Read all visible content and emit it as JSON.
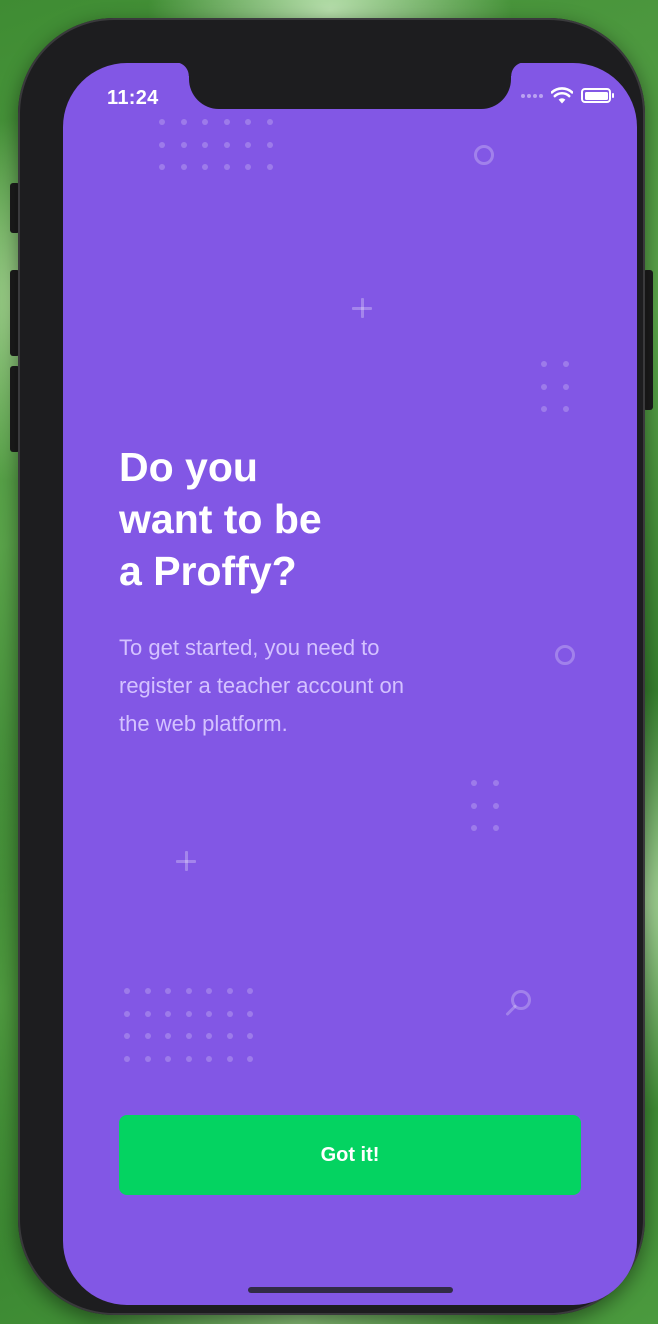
{
  "status_bar": {
    "time": "11:24"
  },
  "page": {
    "title_lines": [
      "Do you",
      "want to be",
      "a Proffy?"
    ],
    "description_lines": [
      "To get started, you need to",
      "register a teacher account on",
      "the web platform."
    ]
  },
  "actions": {
    "confirm_label": "Got it!"
  },
  "colors": {
    "background": "#8257e5",
    "button": "#04d361",
    "text": "#ffffff",
    "description": "#d4c2ff"
  },
  "icons": {
    "wifi": "wifi-icon",
    "battery": "battery-icon",
    "signal": "signal-icon",
    "decor_search": "search-icon",
    "decor_plus": "plus-icon",
    "decor_ring": "ring-icon"
  }
}
